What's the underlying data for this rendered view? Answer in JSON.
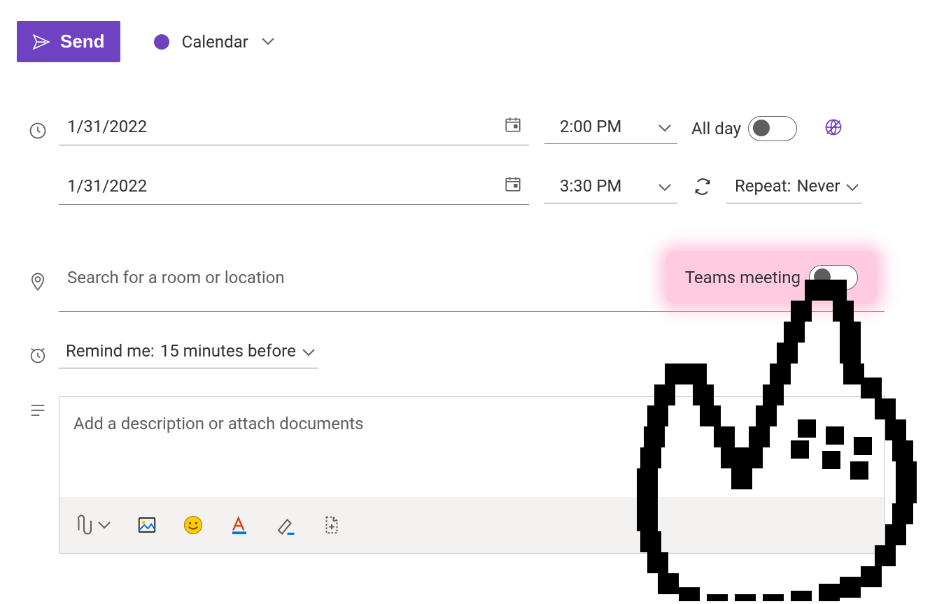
{
  "toolbar": {
    "send_label": "Send",
    "calendar_label": "Calendar"
  },
  "event": {
    "start_date": "1/31/2022",
    "start_time": "2:00 PM",
    "end_date": "1/31/2022",
    "end_time": "3:30 PM",
    "all_day_label": "All day",
    "all_day_on": false,
    "repeat_label": "Repeat:",
    "repeat_value": "Never",
    "location_placeholder": "Search for a room or location",
    "teams_label": "Teams meeting",
    "teams_on": false,
    "remind_label": "Remind me:",
    "remind_value": "15 minutes before",
    "description_placeholder": "Add a description or attach documents"
  },
  "colors": {
    "accent": "#6e42c1",
    "highlight": "#f9b8d5"
  }
}
